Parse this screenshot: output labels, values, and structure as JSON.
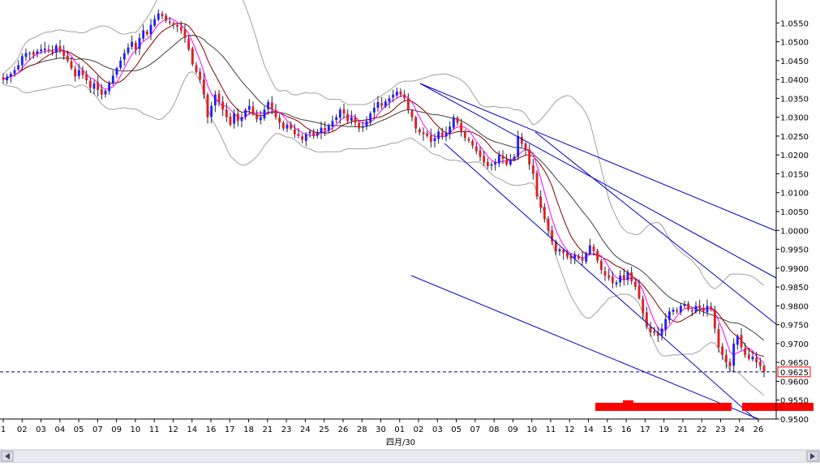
{
  "chart_data": {
    "type": "candlestick",
    "instrument_note": "",
    "current_price": "0.9625",
    "y_axis": {
      "ylim": [
        0.95,
        1.06
      ],
      "ticks": [
        "1.0550",
        "1.0500",
        "1.0450",
        "1.0400",
        "1.0350",
        "1.0300",
        "1.0250",
        "1.0200",
        "1.0150",
        "1.0100",
        "1.0050",
        "1.0000",
        "0.9950",
        "0.9900",
        "0.9850",
        "0.9800",
        "0.9750",
        "0.9700",
        "0.9650",
        "0.9600",
        "0.9550",
        "0.9500"
      ]
    },
    "x_axis": {
      "ticks": [
        "1",
        "02",
        "03",
        "04",
        "05",
        "07",
        "09",
        "10",
        "11",
        "12",
        "14",
        "16",
        "17",
        "18",
        "21",
        "23",
        "24",
        "25",
        "26",
        "28",
        "30",
        "01",
        "02",
        "03",
        "05",
        "07",
        "08",
        "09",
        "10",
        "11",
        "12",
        "14",
        "15",
        "16",
        "17",
        "19",
        "21",
        "22",
        "23",
        "24",
        "26"
      ],
      "month_label": "四月/30"
    },
    "series_closes": [
      1.04,
      1.0408,
      1.0415,
      1.0425,
      1.0438,
      1.0462,
      1.047,
      1.047,
      1.0465,
      1.0475,
      1.048,
      1.0482,
      1.0478,
      1.0472,
      1.049,
      1.048,
      1.0462,
      1.045,
      1.043,
      1.0408,
      1.0425,
      1.0412,
      1.0398,
      1.0378,
      1.039,
      1.0372,
      1.036,
      1.037,
      1.039,
      1.041,
      1.043,
      1.045,
      1.047,
      1.0485,
      1.05,
      1.048,
      1.051,
      1.053,
      1.052,
      1.0545,
      1.056,
      1.0575,
      1.0568,
      1.0556,
      1.055,
      1.0545,
      1.054,
      1.053,
      1.051,
      1.048,
      1.044,
      1.042,
      1.04,
      1.036,
      1.03,
      1.033,
      1.036,
      1.034,
      1.032,
      1.03,
      1.028,
      1.031,
      1.029,
      1.03,
      1.032,
      1.033,
      1.031,
      1.0295,
      1.03,
      1.032,
      1.034,
      1.032,
      1.03,
      1.0285,
      1.027,
      1.028,
      1.027,
      1.0255,
      1.025,
      1.024,
      1.0255,
      1.0262,
      1.025,
      1.0258,
      1.0272,
      1.0265,
      1.0278,
      1.029,
      1.03,
      1.032,
      1.031,
      1.029,
      1.03,
      1.0285,
      1.027,
      1.0275,
      1.029,
      1.031,
      1.0325,
      1.034,
      1.033,
      1.0342,
      1.035,
      1.036,
      1.0368,
      1.036,
      1.035,
      1.032,
      1.03,
      1.027,
      1.026,
      1.0255,
      1.025,
      1.0235,
      1.0245,
      1.0262,
      1.025,
      1.0258,
      1.0275,
      1.03,
      1.0285,
      1.026,
      1.0245,
      1.0238,
      1.0225,
      1.021,
      1.0195,
      1.018,
      1.017,
      1.0175,
      1.018,
      1.02,
      1.019,
      1.0175,
      1.0188,
      1.0195,
      1.025,
      1.023,
      1.0215,
      1.0175,
      1.015,
      1.009,
      1.006,
      1.003,
      1.0,
      0.997,
      0.9945,
      0.995,
      0.994,
      0.993,
      0.9925,
      0.9935,
      0.9925,
      0.992,
      0.994,
      0.996,
      0.9945,
      0.992,
      0.9895,
      0.988,
      0.9875,
      0.986,
      0.9862,
      0.988,
      0.987,
      0.989,
      0.9865,
      0.985,
      0.982,
      0.978,
      0.9745,
      0.973,
      0.9728,
      0.972,
      0.974,
      0.9765,
      0.9785,
      0.979,
      0.9785,
      0.98,
      0.9805,
      0.979,
      0.9785,
      0.98,
      0.9795,
      0.9785,
      0.98,
      0.979,
      0.974,
      0.969,
      0.967,
      0.965,
      0.964,
      0.97,
      0.972,
      0.969,
      0.967,
      0.966,
      0.9665,
      0.965,
      0.964,
      0.9625
    ]
  },
  "colors": {
    "up": "#2020ff",
    "down": "#e02020",
    "ma_fast": "#ff00ff",
    "ma_mid": "#800000",
    "ma_slow": "#404040",
    "bands": "#a0a0a0",
    "channel": "#0000cc",
    "price_line": "#000080",
    "marker": "#ff0000",
    "axis": "#000000",
    "background": "#ffffff",
    "scrollbar": "#e8e8ef"
  }
}
